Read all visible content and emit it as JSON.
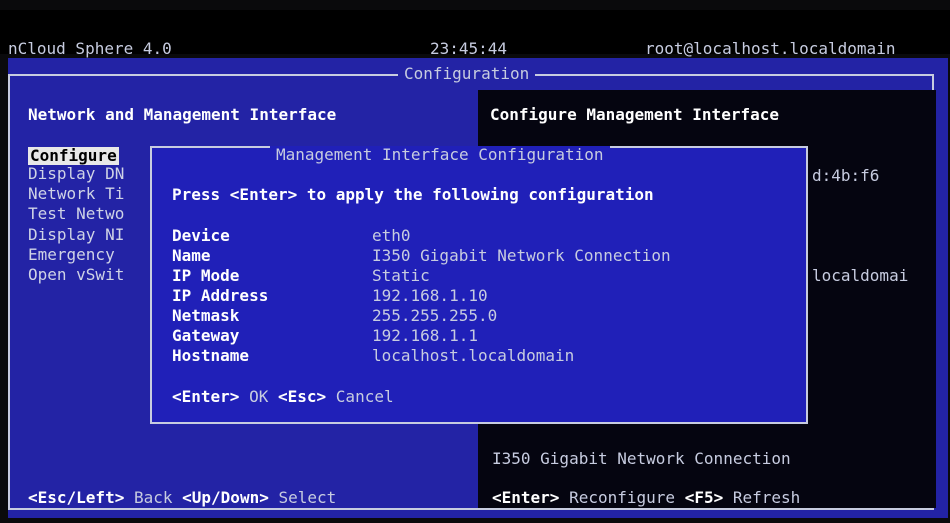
{
  "topbar": {
    "app_title": "nCloud Sphere 4.0",
    "clock": "23:45:44",
    "user": "root@localhost.localdomain"
  },
  "screen": {
    "title": "Configuration"
  },
  "left_panel": {
    "title": "Network and Management Interface",
    "menu": [
      "Configure",
      "Display DN",
      "Network Ti",
      "Test Netwo",
      "Display NI",
      "Emergency",
      "Open vSwit"
    ]
  },
  "right_panel": {
    "title": "Configure Management Interface",
    "mac_fragment": "d:4b:f6",
    "hostname_fragment": "localdomai",
    "nic_name": "I350 Gigabit Network Connection"
  },
  "dialog": {
    "title": "Management Interface Configuration",
    "prompt": "Press <Enter> to apply the following configuration",
    "fields": [
      {
        "label": "Device",
        "value": "eth0"
      },
      {
        "label": "Name",
        "value": "I350 Gigabit Network Connection"
      },
      {
        "label": "IP Mode",
        "value": "Static"
      },
      {
        "label": "IP Address",
        "value": "192.168.1.10"
      },
      {
        "label": "Netmask",
        "value": "255.255.255.0"
      },
      {
        "label": "Gateway",
        "value": "192.168.1.1"
      },
      {
        "label": "Hostname",
        "value": "localhost.localdomain"
      }
    ],
    "ok_key": "<Enter>",
    "ok_label": "OK",
    "cancel_key": "<Esc>",
    "cancel_label": "Cancel"
  },
  "footer": {
    "back_key": "<Esc/Left>",
    "back_label": "Back",
    "select_key": "<Up/Down>",
    "select_label": "Select",
    "reconfigure_key": "<Enter>",
    "reconfigure_label": "Reconfigure",
    "refresh_key": "<F5>",
    "refresh_label": "Refresh"
  },
  "colors": {
    "background": "#2323a5",
    "dialog": "#2020b8",
    "right_pane": "#050510",
    "text": "#c7cce0",
    "highlight": "#ffffff"
  }
}
